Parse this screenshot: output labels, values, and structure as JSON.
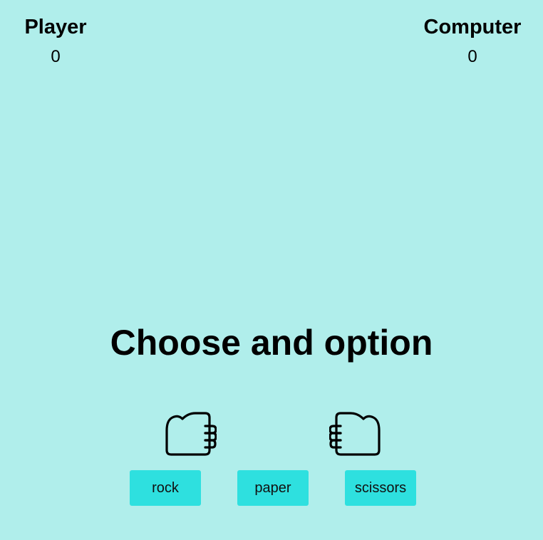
{
  "scoreboard": {
    "player": {
      "label": "Player",
      "score": "0"
    },
    "computer": {
      "label": "Computer",
      "score": "0"
    }
  },
  "message": "Choose and option",
  "hands": {
    "player": "fist-icon",
    "computer": "fist-icon"
  },
  "options": [
    {
      "label": "rock"
    },
    {
      "label": "paper"
    },
    {
      "label": "scissors"
    }
  ],
  "colors": {
    "background": "#b0eeeb",
    "button": "#2ee0df",
    "text": "#000000"
  }
}
